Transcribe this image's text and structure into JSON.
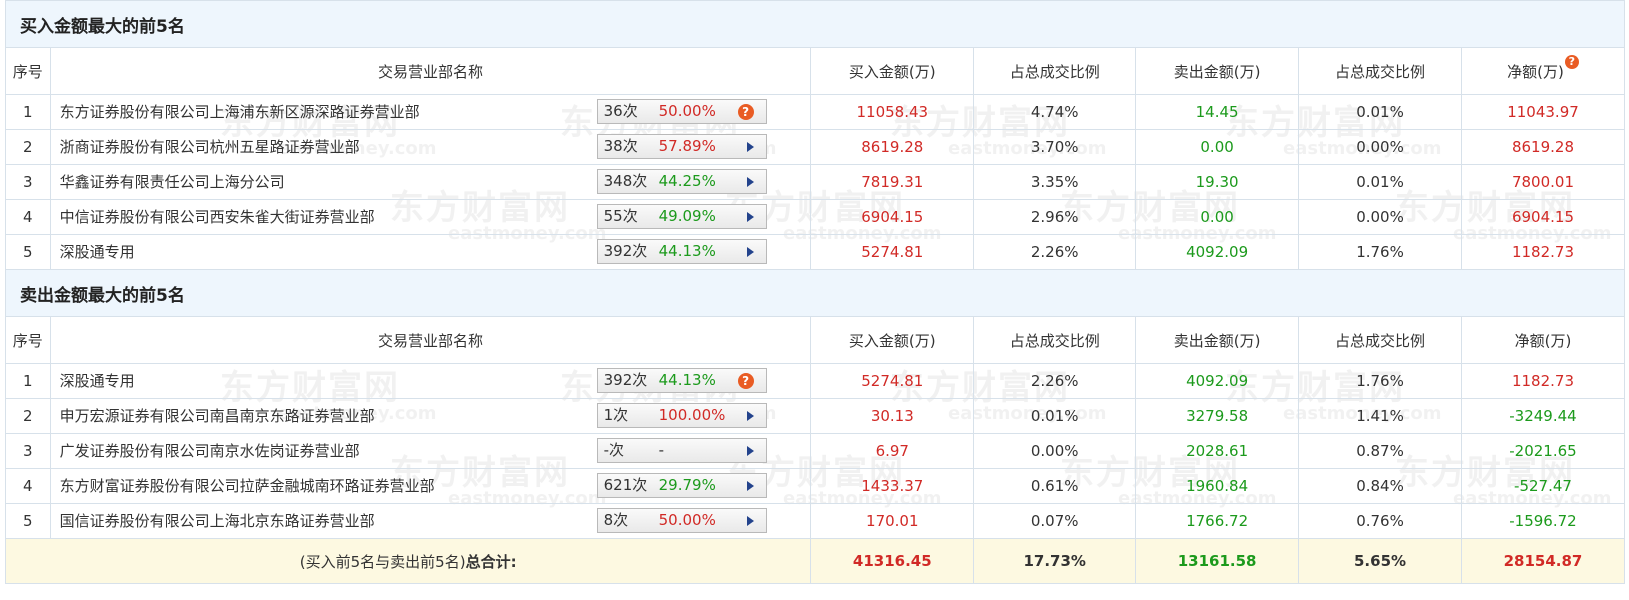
{
  "buy_section": {
    "title": "买入金额最大的前5名",
    "headers": {
      "seq": "序号",
      "name": "交易营业部名称",
      "buy": "买入金额(万)",
      "buy_ratio": "占总成交比例",
      "sell": "卖出金额(万)",
      "sell_ratio": "占总成交比例",
      "net": "净额(万)"
    },
    "rows": [
      {
        "seq": "1",
        "name": "东方证券股份有限公司上海浦东新区源深路证券营业部",
        "times": "36次",
        "pct": "50.00%",
        "buy": "11058.43",
        "buy_ratio": "4.74%",
        "sell": "14.45",
        "sell_ratio": "0.01%",
        "net": "11043.97"
      },
      {
        "seq": "2",
        "name": "浙商证券股份有限公司杭州五星路证券营业部",
        "times": "38次",
        "pct": "57.89%",
        "buy": "8619.28",
        "buy_ratio": "3.70%",
        "sell": "0.00",
        "sell_ratio": "0.00%",
        "net": "8619.28"
      },
      {
        "seq": "3",
        "name": "华鑫证券有限责任公司上海分公司",
        "times": "348次",
        "pct": "44.25%",
        "buy": "7819.31",
        "buy_ratio": "3.35%",
        "sell": "19.30",
        "sell_ratio": "0.01%",
        "net": "7800.01"
      },
      {
        "seq": "4",
        "name": "中信证券股份有限公司西安朱雀大街证券营业部",
        "times": "55次",
        "pct": "49.09%",
        "buy": "6904.15",
        "buy_ratio": "2.96%",
        "sell": "0.00",
        "sell_ratio": "0.00%",
        "net": "6904.15"
      },
      {
        "seq": "5",
        "name": "深股通专用",
        "times": "392次",
        "pct": "44.13%",
        "buy": "5274.81",
        "buy_ratio": "2.26%",
        "sell": "4092.09",
        "sell_ratio": "1.76%",
        "net": "1182.73"
      }
    ]
  },
  "sell_section": {
    "title": "卖出金额最大的前5名",
    "headers": {
      "seq": "序号",
      "name": "交易营业部名称",
      "buy": "买入金额(万)",
      "buy_ratio": "占总成交比例",
      "sell": "卖出金额(万)",
      "sell_ratio": "占总成交比例",
      "net": "净额(万)"
    },
    "rows": [
      {
        "seq": "1",
        "name": "深股通专用",
        "times": "392次",
        "pct": "44.13%",
        "buy": "5274.81",
        "buy_ratio": "2.26%",
        "sell": "4092.09",
        "sell_ratio": "1.76%",
        "net": "1182.73"
      },
      {
        "seq": "2",
        "name": "申万宏源证券有限公司南昌南京东路证券营业部",
        "times": "1次",
        "pct": "100.00%",
        "buy": "30.13",
        "buy_ratio": "0.01%",
        "sell": "3279.58",
        "sell_ratio": "1.41%",
        "net": "-3249.44"
      },
      {
        "seq": "3",
        "name": "广发证券股份有限公司南京水佐岗证券营业部",
        "times": "-次",
        "pct": "-",
        "buy": "6.97",
        "buy_ratio": "0.00%",
        "sell": "2028.61",
        "sell_ratio": "0.87%",
        "net": "-2021.65"
      },
      {
        "seq": "4",
        "name": "东方财富证券股份有限公司拉萨金融城南环路证券营业部",
        "times": "621次",
        "pct": "29.79%",
        "buy": "1433.37",
        "buy_ratio": "0.61%",
        "sell": "1960.84",
        "sell_ratio": "0.84%",
        "net": "-527.47"
      },
      {
        "seq": "5",
        "name": "国信证券股份有限公司上海北京东路证券营业部",
        "times": "8次",
        "pct": "50.00%",
        "buy": "170.01",
        "buy_ratio": "0.07%",
        "sell": "1766.72",
        "sell_ratio": "0.76%",
        "net": "-1596.72"
      }
    ]
  },
  "total": {
    "label_prefix": "(买入前5名与卖出前5名)",
    "label_bold": "总合计:",
    "buy": "41316.45",
    "buy_ratio": "17.73%",
    "sell": "13161.58",
    "sell_ratio": "5.65%",
    "net": "28154.87"
  },
  "icons": {
    "question": "?",
    "arrow": "right-arrow-icon"
  },
  "watermark": {
    "cn": "东方财富网",
    "en": "eastmoney.com"
  },
  "colors": {
    "red": "#d12a26",
    "green": "#1c9a1c",
    "header_bg": "#eef6fd",
    "total_bg": "#fdf9e1",
    "arrow": "#23438c",
    "question_icon": "#e95c24"
  }
}
